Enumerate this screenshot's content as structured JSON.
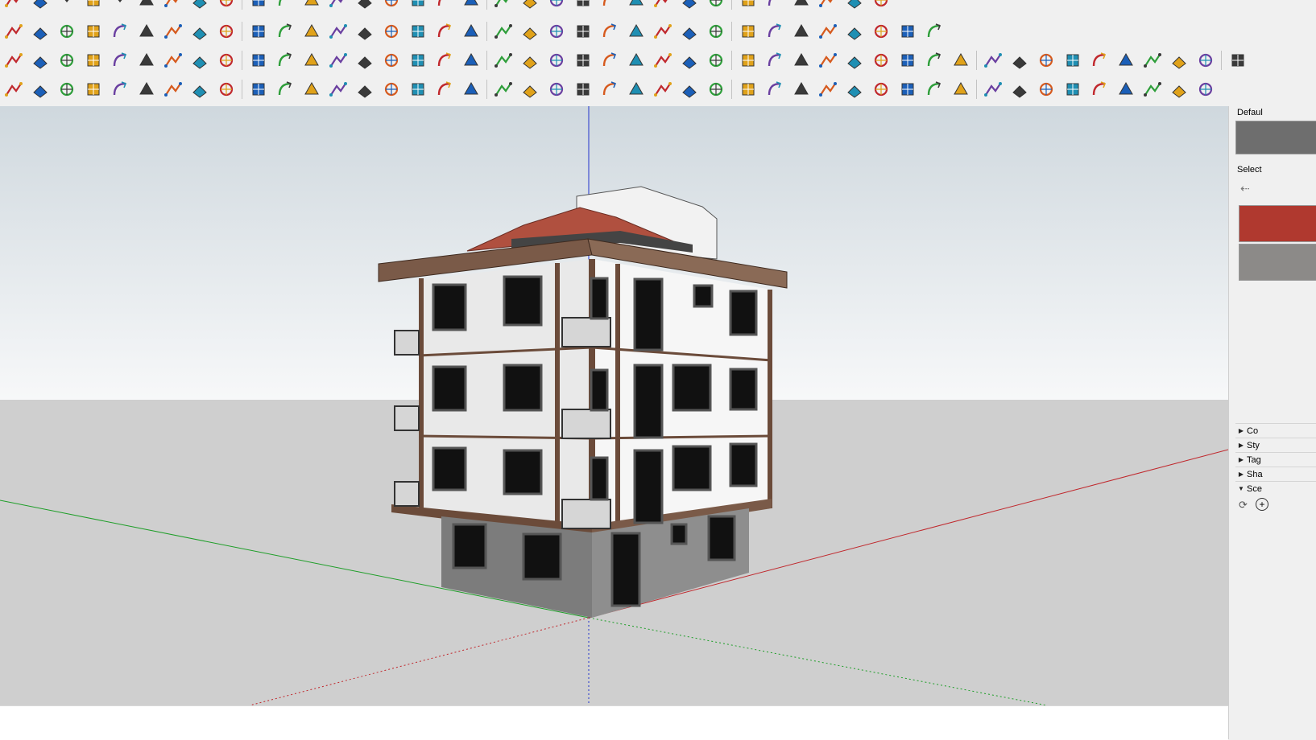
{
  "colors": {
    "sky_top": "#cfd8de",
    "sky_bottom": "#f7f8f9",
    "ground": "#cfcfcf",
    "axis_red": "#c0282d",
    "axis_green": "#1e9e28",
    "axis_blue": "#2233cc",
    "wall": "#f1f1f1",
    "trim": "#6b4b3a",
    "base": "#838383",
    "roof": "#b0503f"
  },
  "toolbars": {
    "row0": [
      "eraser-icon",
      "pencil-icon",
      "arrow-dropdown-icon",
      "paint-icon",
      "arrow-dropdown-icon",
      "pushpull-icon",
      "orbit-icon",
      "move-icon",
      "rotate-icon",
      "scale-icon",
      "tape-icon",
      "dimension-icon",
      "protractor-icon",
      "component-icon",
      "sandbox-icon",
      "zoom-icon",
      "zoom-window-icon",
      "section-icon",
      "layers-icon",
      "match-photo-icon",
      "warehouse-icon",
      "extension-icon",
      "solid-tools-icon",
      "style-icon",
      "style-icon",
      "style-icon",
      "style-icon",
      "shadow-icon",
      "shadow-icon",
      "shadow-icon",
      "play-icon",
      "stop-icon",
      "geo-icon"
    ],
    "row1": [
      "curve-icon",
      "bezier-icon",
      "intersect-icon",
      "rotate3d-icon",
      "offset-icon",
      "follow-icon",
      "box-icon",
      "sphere-icon",
      "lathe-icon",
      "corner-icon",
      "fillet-icon",
      "line-cut-icon",
      "sweep-icon",
      "loft-icon",
      "extrude-icon",
      "columns-icon",
      "grid-icon",
      "hand-icon",
      "surface-icon",
      "pyramid-icon",
      "stairs-icon",
      "slope-icon",
      "path-icon",
      "ramp-icon",
      "arch-icon",
      "tile-icon",
      "wall-icon",
      "hatch-icon",
      "stack-icon",
      "fence-icon",
      "frame-icon",
      "web-icon",
      "stripes-icon",
      "rail-icon",
      "home-icon"
    ],
    "row2": [
      "face-blue-icon",
      "face-yellow-icon",
      "face-green-icon",
      "face-red-icon",
      "face-stack-icon",
      "undo-arc-icon",
      "red-square-icon",
      "list-icon",
      "flag-icon",
      "box-fill-icon",
      "link-icon",
      "bend-icon",
      "dots-line-icon",
      "red-cross-icon",
      "green-cross-icon",
      "blue-x-icon",
      "cone-icon",
      "pyramid-icon",
      "warning-triangle-icon",
      "loop-icon",
      "refresh-icon",
      "refresh-icon",
      "move-cross-icon",
      "cube-icon",
      "redo-icon",
      "puzzle-icon",
      "cube-arrow-icon",
      "cube-red-icon",
      "cube-pair-icon",
      "gem-icon",
      "grid-fill-icon",
      "frame-icon",
      "orange-grid-icon",
      "orange-grid-icon",
      "orange-grid-icon",
      "red-x-icon",
      "dotted-arc-icon",
      "cluster-icon",
      "pen-icon",
      "ruler-icon",
      "brush-icon",
      "prism-icon",
      "cube-paint-icon",
      "arrow-3d-icon",
      "fork-icon",
      "scale-balance-icon"
    ],
    "row3": [
      "walk-icon",
      "network-icon",
      "arc-icon",
      "zigzag-icon",
      "spring-icon",
      "wave-icon",
      "spiral-icon",
      "curve-c-icon",
      "square-icon",
      "circle-icon",
      "arc-c-icon",
      "freehand-icon",
      "hook-icon",
      "arc-small-icon",
      "arc-red-icon",
      "polyline-icon",
      "polygon-icon",
      "wrench-icon",
      "ellipse-icon",
      "sector-icon",
      "sheet-icon",
      "cube-push-icon",
      "select-icon",
      "scale-up-icon",
      "scale-down-icon",
      "lines-icon",
      "lines-plus-icon",
      "lines-minus-icon",
      "dash-icon",
      "dash-plus-icon",
      "dash-minus-icon",
      "grid-x-icon",
      "grid-icon",
      "grid-red-icon",
      "table-icon",
      "table-blue-icon",
      "grid-skew-icon",
      "wall-grid-icon",
      "brick-icon",
      "dome-icon",
      "checker-icon",
      "copy-icon",
      "paste-icon",
      "tree-icon",
      "column-icon"
    ]
  },
  "tray": {
    "default_label": "Defaul",
    "select_label": "Select",
    "panels": [
      {
        "label": "Co",
        "expanded": false
      },
      {
        "label": "Sty",
        "expanded": false
      },
      {
        "label": "Tag",
        "expanded": false
      },
      {
        "label": "Sha",
        "expanded": false
      },
      {
        "label": "Sce",
        "expanded": true
      }
    ]
  }
}
